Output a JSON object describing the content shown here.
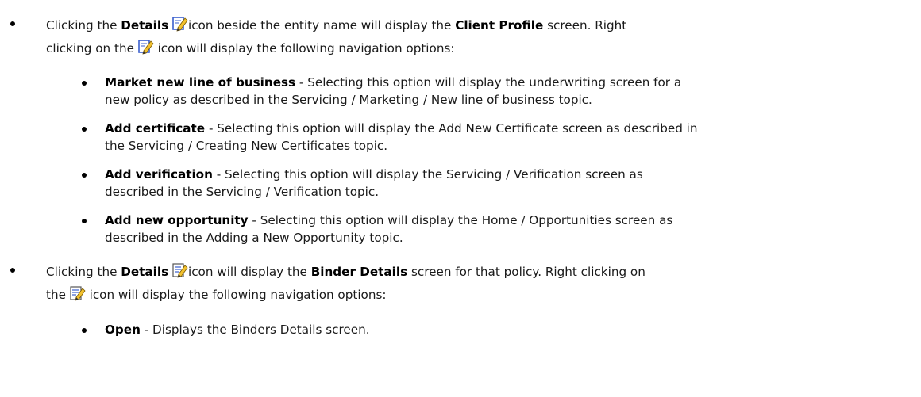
{
  "bullet1": {
    "text1": "Clicking the ",
    "details_label": "Details",
    "text2": "icon beside the entity name will display the ",
    "screen_name": "Client Profile",
    "text3": " screen. Right",
    "text4": "clicking on the ",
    "text5": " icon will display the following navigation options:",
    "icon": "edit-pencil-icon",
    "sub_items": [
      {
        "label": "Market new line of business",
        "line1": " - Selecting this option will display the underwriting screen for a",
        "line2": "new policy as described in the Servicing / Marketing / New line of business topic."
      },
      {
        "label": "Add certificate",
        "line1": " - Selecting this option will display the Add New Certificate screen as described in",
        "line2": "the Servicing / Creating New Certificates topic."
      },
      {
        "label": "Add verification",
        "line1": " - Selecting this option will display the Servicing / Verification screen as",
        "line2": "described in the Servicing / Verification topic."
      },
      {
        "label": "Add new opportunity",
        "line1": " - Selecting this option will display the Home / Opportunities screen as",
        "line2": "described in the Adding a New Opportunity topic."
      }
    ]
  },
  "bullet2": {
    "text1": "Clicking the ",
    "details_label": "Details",
    "text2": "icon will display the ",
    "screen_name": "Binder Details",
    "text3": " screen for that policy. Right clicking on",
    "text4": "the ",
    "text5": " icon will display the following navigation options:",
    "icon": "edit-document-icon",
    "sub_items": [
      {
        "label": "Open",
        "line1": " - Displays the Binders Details screen."
      }
    ]
  },
  "colors": {
    "text": "#1a1a1a",
    "bold": "#000000",
    "icon_blue": "#3a5fcd",
    "icon_yellow": "#f2c12e"
  }
}
